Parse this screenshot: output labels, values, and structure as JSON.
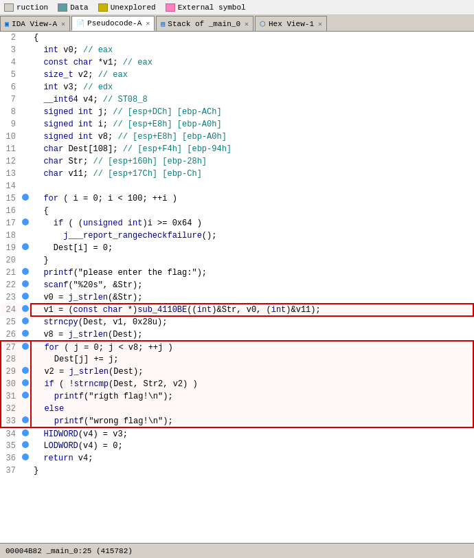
{
  "legend": {
    "items": [
      {
        "label": "ruction",
        "color": "#d4d0c8",
        "border": "#808080"
      },
      {
        "label": "Data",
        "color": "#d4d0c8",
        "border": "#808080"
      },
      {
        "label": "Unexplored",
        "color": "#c8b400",
        "border": "#a09000"
      },
      {
        "label": "External symbol",
        "color": "#ff80c0",
        "border": "#cc6090"
      }
    ]
  },
  "tabs": [
    {
      "label": "IDA View-A",
      "active": false,
      "icon": "ida"
    },
    {
      "label": "Pseudocode-A",
      "active": true,
      "icon": "pseudo"
    },
    {
      "label": "Stack of _main_0",
      "active": false,
      "icon": "stack"
    },
    {
      "label": "Hex View-1",
      "active": false,
      "icon": "hex"
    }
  ],
  "lines": [
    {
      "num": 2,
      "dot": false,
      "code": "{"
    },
    {
      "num": 3,
      "dot": false,
      "code": "  int v0; // eax",
      "comment_start": 9
    },
    {
      "num": 4,
      "dot": false,
      "code": "  const char *v1; // eax"
    },
    {
      "num": 5,
      "dot": false,
      "code": "  size_t v2; // eax"
    },
    {
      "num": 6,
      "dot": false,
      "code": "  int v3; // edx"
    },
    {
      "num": 7,
      "dot": false,
      "code": "  __int64 v4; // ST08_8"
    },
    {
      "num": 8,
      "dot": false,
      "code": "  signed int j; // [esp+DCh] [ebp-ACh]"
    },
    {
      "num": 9,
      "dot": false,
      "code": "  signed int i; // [esp+E8h] [ebp-A0h]"
    },
    {
      "num": 10,
      "dot": false,
      "code": "  signed int v8; // [esp+E8h] [ebp-A0h]"
    },
    {
      "num": 11,
      "dot": false,
      "code": "  char Dest[108]; // [esp+F4h] [ebp-94h]"
    },
    {
      "num": 12,
      "dot": false,
      "code": "  char Str; // [esp+160h] [ebp-28h]"
    },
    {
      "num": 13,
      "dot": false,
      "code": "  char v11; // [esp+17Ch] [ebp-Ch]"
    },
    {
      "num": 14,
      "dot": false,
      "code": ""
    },
    {
      "num": 15,
      "dot": true,
      "code": "  for ( i = 0; i < 100; ++i )"
    },
    {
      "num": 16,
      "dot": false,
      "code": "  {"
    },
    {
      "num": 17,
      "dot": true,
      "code": "    if ( (unsigned int)i >= 0x64 )"
    },
    {
      "num": 18,
      "dot": false,
      "code": "      j___report_rangecheckfailure();"
    },
    {
      "num": 19,
      "dot": true,
      "code": "    Dest[i] = 0;"
    },
    {
      "num": 20,
      "dot": false,
      "code": "  }"
    },
    {
      "num": 21,
      "dot": true,
      "code": "  printf(\"please enter the flag:\");"
    },
    {
      "num": 22,
      "dot": true,
      "code": "  scanf(\"%20s\", &Str);"
    },
    {
      "num": 23,
      "dot": true,
      "code": "  v0 = j_strlen(&Str);"
    },
    {
      "num": 24,
      "dot": true,
      "code": "  v1 = (const char *)sub_4110BE((int)&Str, v0, (int)&v11);",
      "highlight": "red-single"
    },
    {
      "num": 25,
      "dot": true,
      "code": "  strncpy(Dest, v1, 0x28u);"
    },
    {
      "num": 26,
      "dot": true,
      "code": "  v8 = j_strlen(Dest);"
    },
    {
      "num": 27,
      "dot": true,
      "code": "  for ( j = 0; j < v8; ++j )",
      "highlight": "red-block-top"
    },
    {
      "num": 28,
      "dot": false,
      "code": "    Dest[j] += j;",
      "highlight": "red-block-mid"
    },
    {
      "num": 29,
      "dot": true,
      "code": "  v2 = j_strlen(Dest);",
      "highlight": "red-block-mid"
    },
    {
      "num": 30,
      "dot": true,
      "code": "  if ( !strncmp(Dest, Str2, v2) )",
      "highlight": "red-block-mid"
    },
    {
      "num": 31,
      "dot": true,
      "code": "    printf(\"rigth flag!\\n\");",
      "highlight": "red-block-mid"
    },
    {
      "num": 32,
      "dot": false,
      "code": "  else",
      "highlight": "red-block-mid"
    },
    {
      "num": 33,
      "dot": true,
      "code": "    printf(\"wrong flag!\\n\");",
      "highlight": "red-block-bot"
    },
    {
      "num": 34,
      "dot": true,
      "code": "  HIDWORD(v4) = v3;"
    },
    {
      "num": 35,
      "dot": true,
      "code": "  LODWORD(v4) = 0;"
    },
    {
      "num": 36,
      "dot": true,
      "code": "  return v4;"
    },
    {
      "num": 37,
      "dot": false,
      "code": "}"
    }
  ],
  "status": "00004B82 _main_0:25 (415782)"
}
